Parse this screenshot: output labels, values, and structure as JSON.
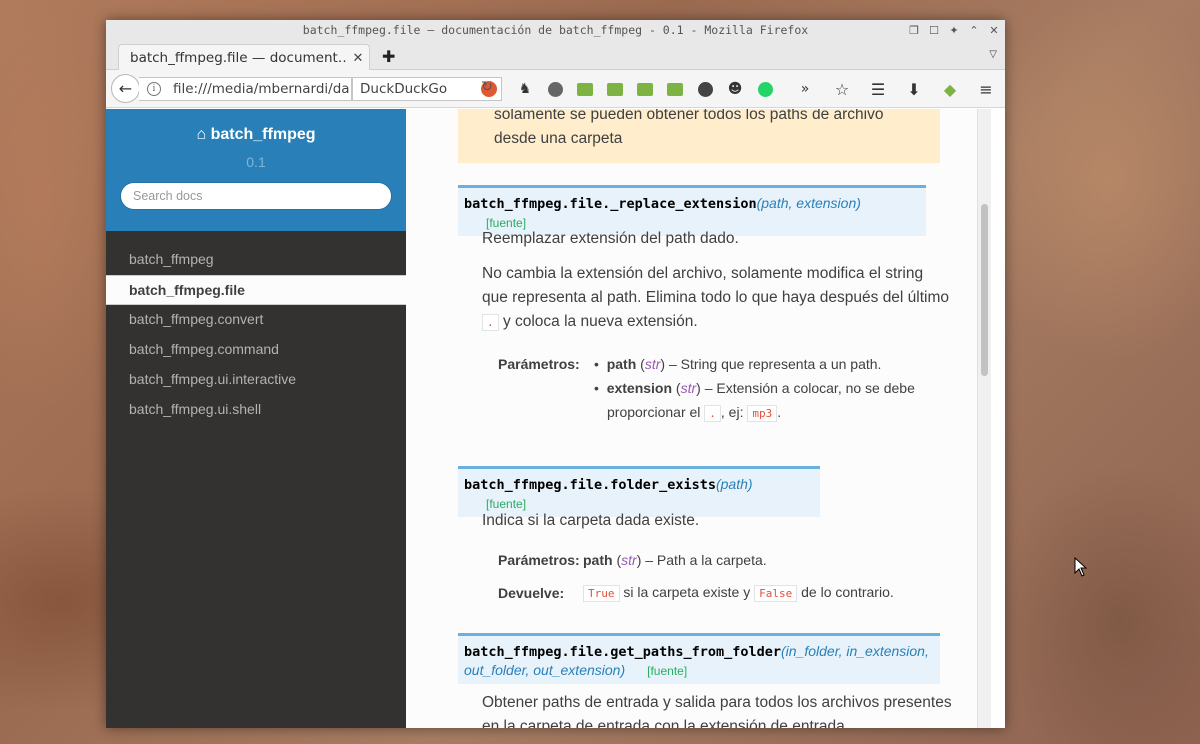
{
  "window": {
    "title": "batch_ffmpeg.file — documentación de batch_ffmpeg - 0.1 - Mozilla Firefox"
  },
  "tab": {
    "label": "batch_ffmpeg.file — document…",
    "close": "✕"
  },
  "navbar": {
    "url": "file:///media/mbernardi/da",
    "search_placeholder": "DuckDuckGo",
    "overflow": "»"
  },
  "sidebar": {
    "project": "batch_ffmpeg",
    "version": "0.1",
    "search_placeholder": "Search docs",
    "items": [
      {
        "label": "batch_ffmpeg"
      },
      {
        "label": "batch_ffmpeg.file"
      },
      {
        "label": "batch_ffmpeg.convert"
      },
      {
        "label": "batch_ffmpeg.command"
      },
      {
        "label": "batch_ffmpeg.ui.interactive"
      },
      {
        "label": "batch_ffmpeg.ui.shell"
      }
    ]
  },
  "main": {
    "note_text": "solamente se pueden obtener todos los paths de archivo desde una carpeta",
    "functions": [
      {
        "name": "batch_ffmpeg.file._replace_extension",
        "params": "(path, extension)",
        "source": "[fuente]",
        "summary": "Reemplazar extensión del path dado.",
        "desc_1": "No cambia la extensión del archivo, solamente modifica el string que representa al path. Elimina todo lo que haya después del último",
        "desc_code": ".",
        "desc_2": "y coloca la nueva extensión.",
        "params_label": "Parámetros:",
        "param_items": [
          {
            "name": "path",
            "type": "str",
            "desc": "– String que representa a un path."
          },
          {
            "name": "extension",
            "type": "str",
            "desc": "– Extensión a colocar, no se debe",
            "desc2": "proporcionar el",
            "code1": ".",
            "mid": ", ej:",
            "code2": "mp3",
            "end": "."
          }
        ]
      },
      {
        "name": "batch_ffmpeg.file.folder_exists",
        "params": "(path)",
        "source": "[fuente]",
        "summary": "Indica si la carpeta dada existe.",
        "params_label": "Parámetros:",
        "param_name": "path",
        "param_type": "str",
        "param_desc": "– Path a la carpeta.",
        "returns_label": "Devuelve:",
        "ret_code1": "True",
        "ret_mid": "si la carpeta existe y",
        "ret_code2": "False",
        "ret_end": "de lo contrario."
      },
      {
        "name": "batch_ffmpeg.file.get_paths_from_folder",
        "params_line1": "(in_folder, in_extension,",
        "params_line2": "out_folder, out_extension",
        "params_close": ")",
        "source": "[fuente]",
        "summary": "Obtener paths de entrada y salida para todos los archivos presentes en la carpeta de entrada con la extensión de entrada"
      }
    ]
  }
}
